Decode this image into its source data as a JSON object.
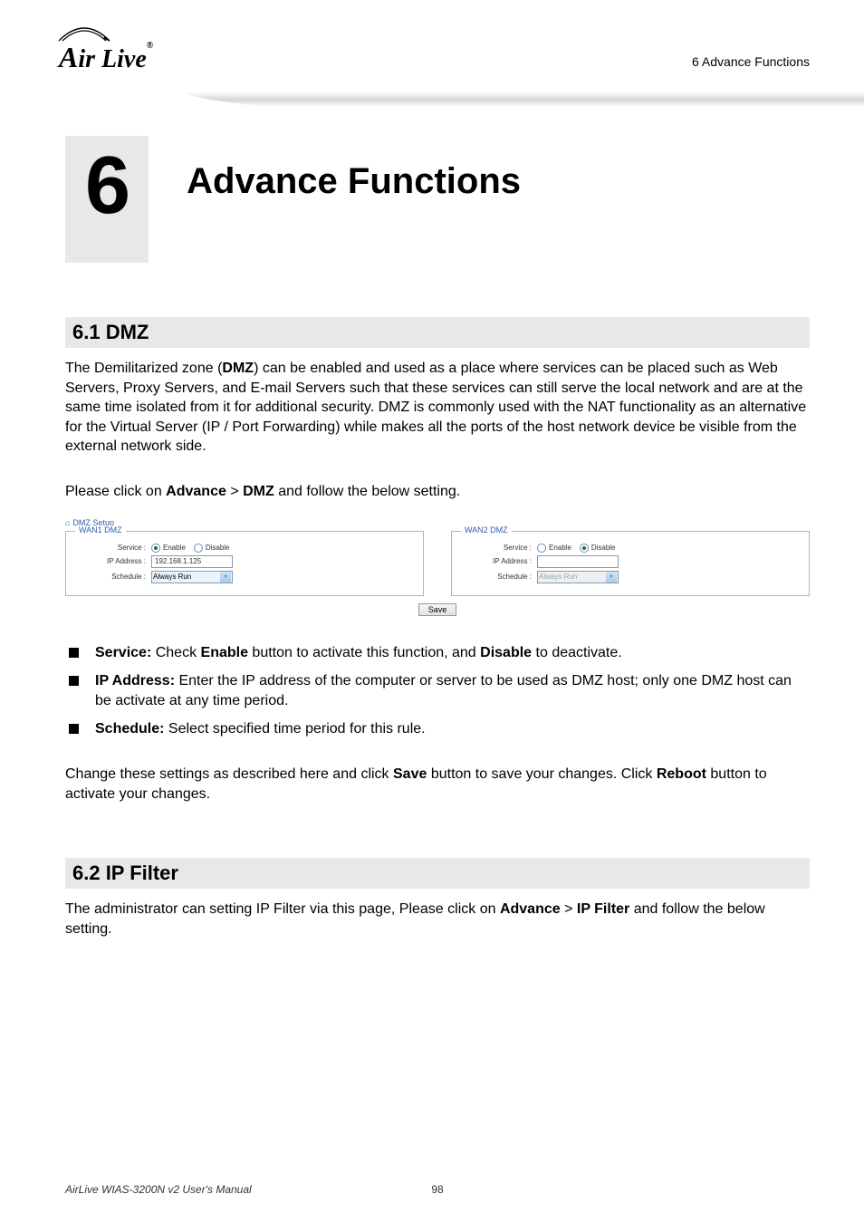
{
  "header": {
    "section_label": "6 Advance Functions",
    "logo_text": "ir Live",
    "logo_prefix": "A",
    "logo_reg": "®"
  },
  "chapter": {
    "number": "6",
    "title": "Advance Functions"
  },
  "sec61": {
    "heading": "6.1  DMZ",
    "para1_pre": "The Demilitarized zone (",
    "para1_bold": "DMZ",
    "para1_post": ") can be enabled and used as a place where services can be placed such as Web Servers, Proxy Servers, and E-mail Servers such that these services can still serve the local network and are at the same time isolated from it for additional security. DMZ is commonly used with the NAT functionality as an alternative for the Virtual Server (IP / Port Forwarding) while makes all the ports of the host network device be visible from the external network side.",
    "para2_pre": "Please click on ",
    "para2_b1": "Advance",
    "para2_mid": " > ",
    "para2_b2": "DMZ",
    "para2_post": " and follow the below setting.",
    "bullets": {
      "b1_b1": "Service:",
      "b1_mid1": " Check ",
      "b1_b2": "Enable",
      "b1_mid2": " button to activate this function, and ",
      "b1_b3": "Disable",
      "b1_post": " to deactivate.",
      "b2_b1": "IP Address:",
      "b2_post": " Enter the IP address of the computer or server to be used as DMZ host; only one DMZ host can be activate at any time period.",
      "b3_b1": "Schedule:",
      "b3_post": " Select specified time period for this rule."
    },
    "para3_pre": "Change these settings as described here and click ",
    "para3_b1": "Save",
    "para3_mid": " button to save your changes. Click ",
    "para3_b2": "Reboot",
    "para3_post": " button to activate your changes."
  },
  "screenshot": {
    "breadcrumb": "DMZ Setup",
    "wan1": {
      "legend": "WAN1 DMZ",
      "service_label": "Service :",
      "enable": "Enable",
      "disable": "Disable",
      "ip_label": "IP Address :",
      "ip_value": "192.168.1.125",
      "sched_label": "Schedule :",
      "sched_value": "Always Run"
    },
    "wan2": {
      "legend": "WAN2 DMZ",
      "service_label": "Service :",
      "enable": "Enable",
      "disable": "Disable",
      "ip_label": "IP Address :",
      "ip_value": "",
      "sched_label": "Schedule :",
      "sched_value": "Always Run"
    },
    "save": "Save"
  },
  "sec62": {
    "heading": "6.2  IP Filter",
    "para1_pre": "The administrator can setting IP Filter via this page, Please click on ",
    "para1_b1": "Advance",
    "para1_mid": " > ",
    "para1_b2": "IP Filter",
    "para1_post": " and follow the below setting."
  },
  "footer": {
    "manual": "AirLive WIAS-3200N v2 User's Manual",
    "page": "98"
  }
}
